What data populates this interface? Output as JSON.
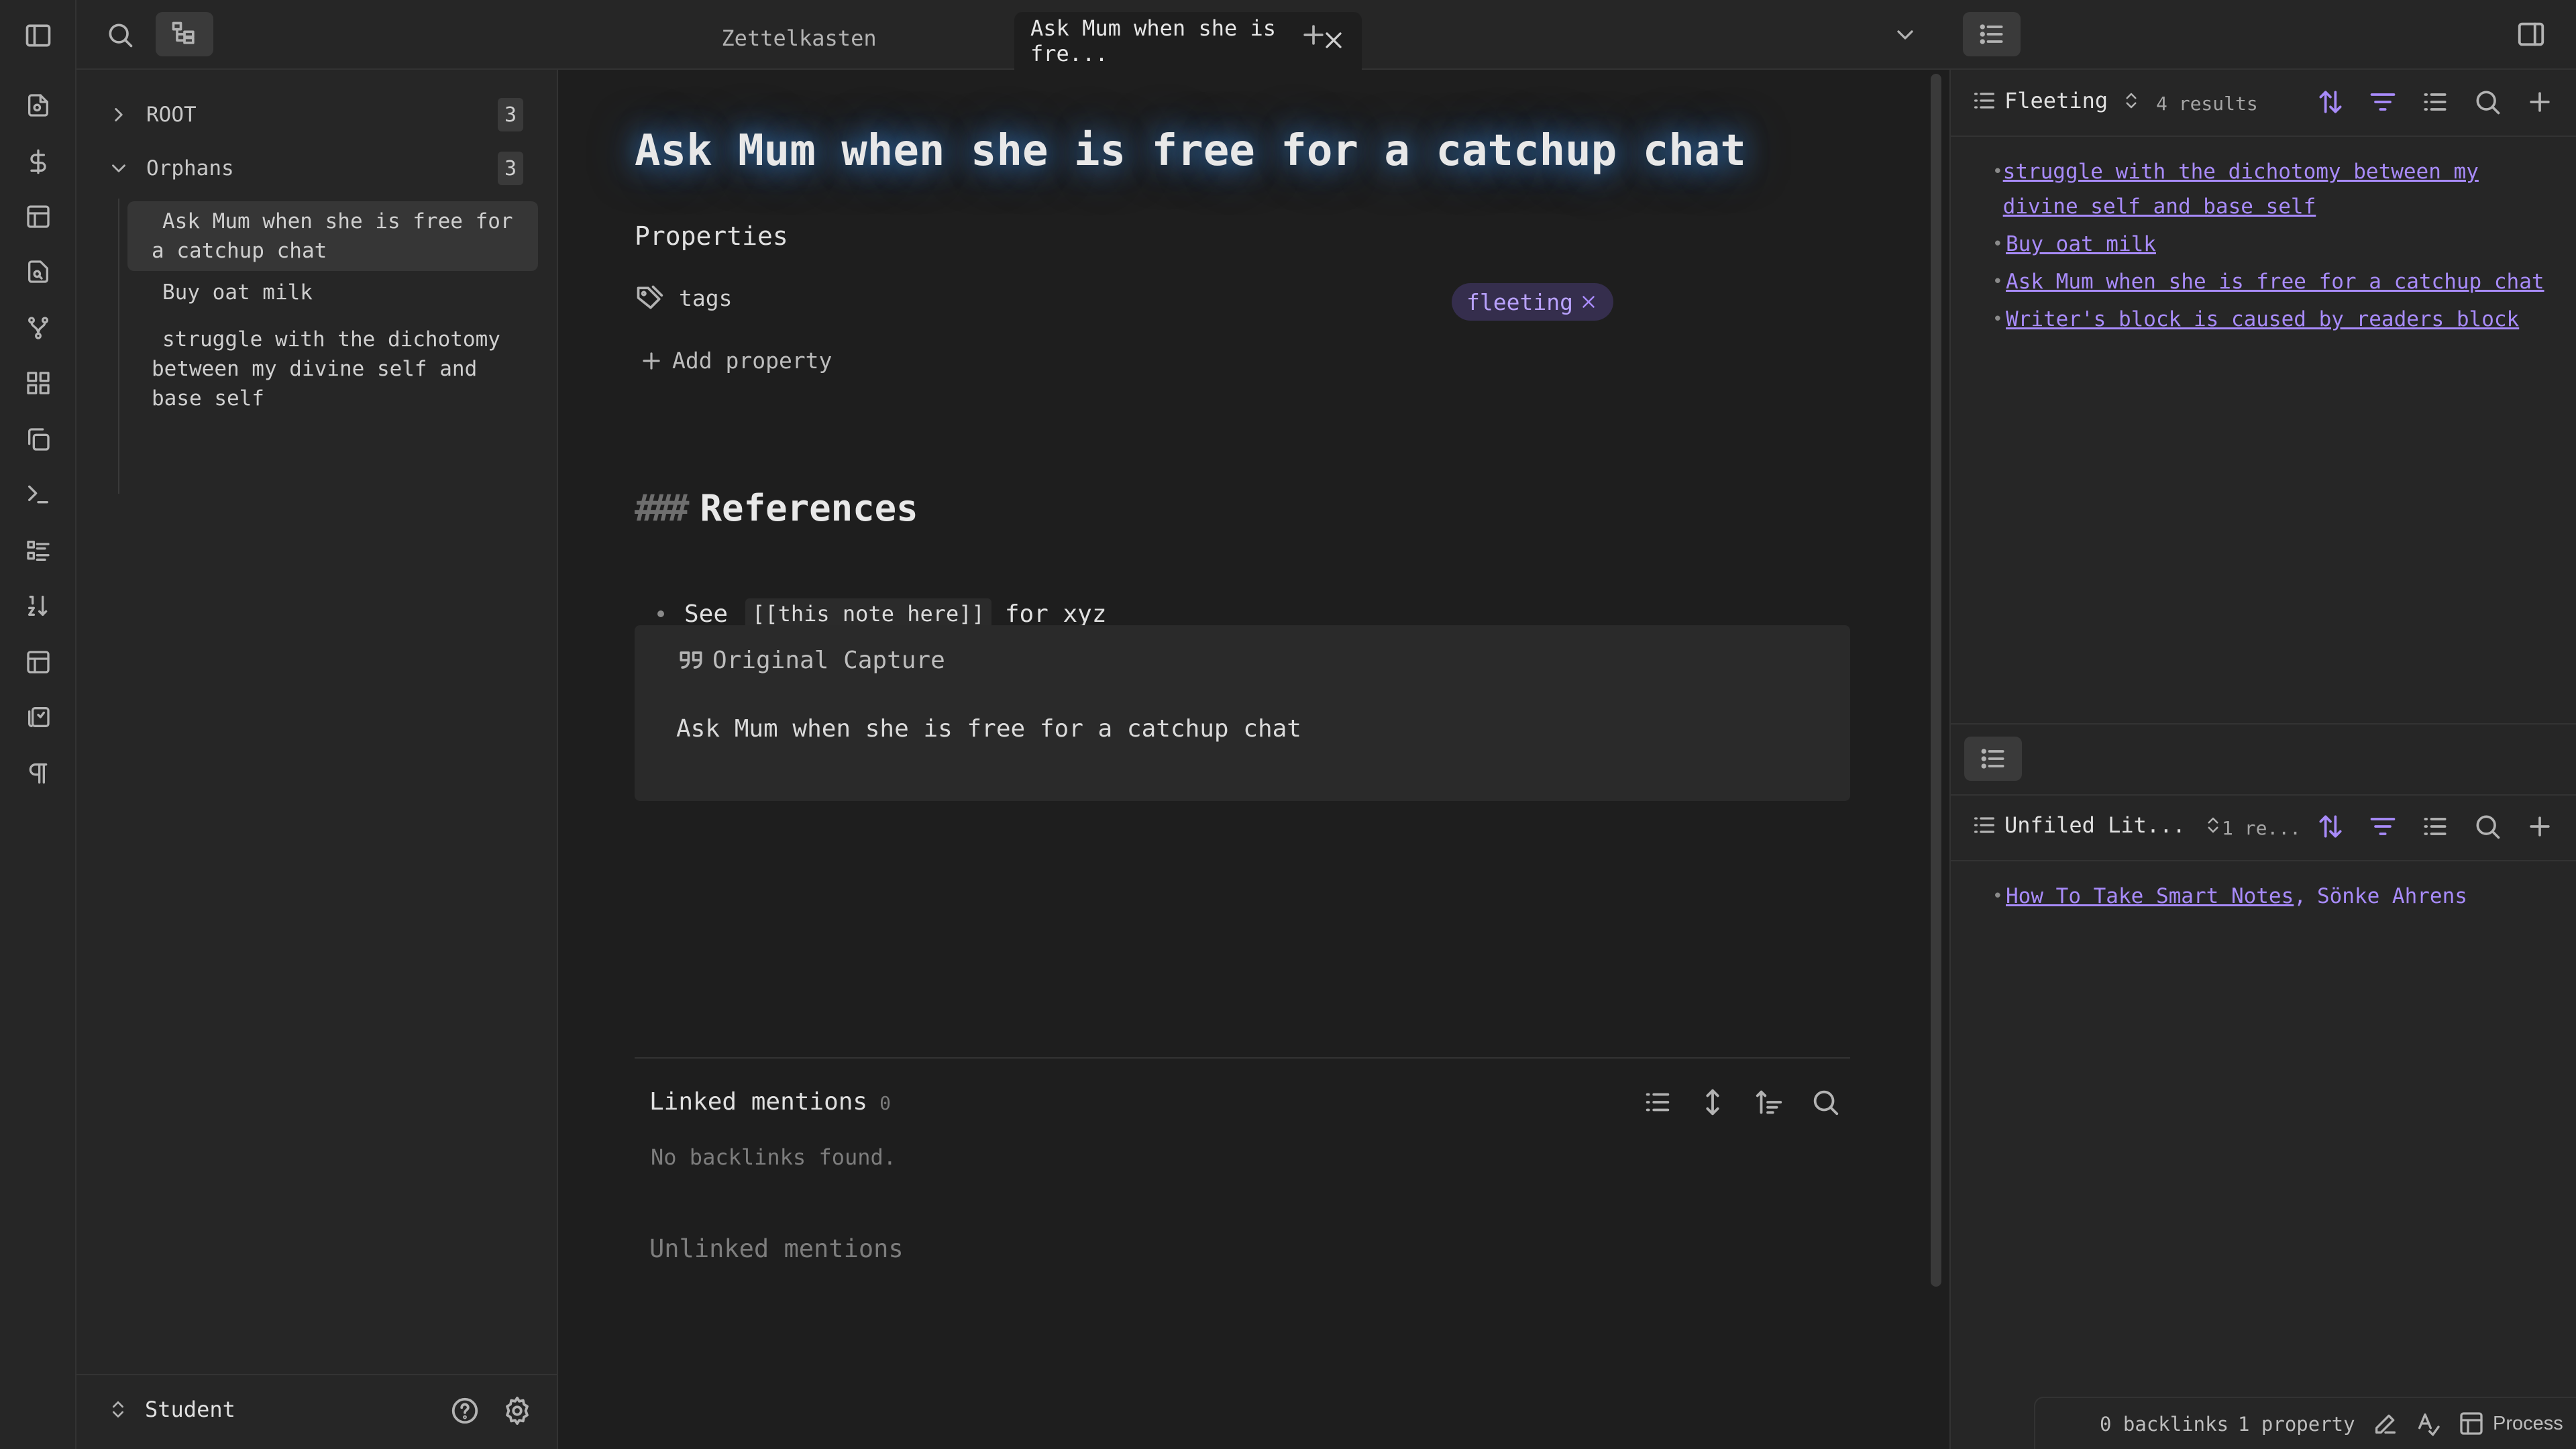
{
  "tabs": [
    {
      "label": "Zettelkasten"
    },
    {
      "label": "Ask Mum when she is fre..."
    }
  ],
  "sidebar": {
    "folders": [
      {
        "label": "ROOT",
        "count": "3"
      },
      {
        "label": "Orphans",
        "count": "3"
      }
    ],
    "items": [
      {
        "label": "Ask Mum when she is free for a catchup chat"
      },
      {
        "label": "Buy oat milk"
      },
      {
        "label": "struggle with the dichotomy between my divine self and base self"
      }
    ],
    "vault_name": "Student"
  },
  "note": {
    "title": "Ask Mum when she is free for a catchup chat",
    "properties_heading": "Properties",
    "property_name": "tags",
    "tag_value": "fleeting",
    "add_property": "Add property",
    "references_heading": "References",
    "references_hash": "###",
    "bullet_prefix": "See",
    "bullet_link": "[[this note here]]",
    "bullet_suffix": "for xyz",
    "callout_title": "Original Capture",
    "callout_body": "Ask Mum when she is free for a catchup chat",
    "linked_mentions": "Linked mentions",
    "linked_count": "0",
    "no_backlinks": "No backlinks found.",
    "unlinked_mentions": "Unlinked mentions"
  },
  "right_top": {
    "query_name": "Fleeting",
    "results": "4 results",
    "items": [
      "struggle with the dichotomy between my divine self and base self",
      "Buy oat milk",
      "Ask Mum when she is free for a catchup chat",
      "Writer's block is caused by readers block"
    ]
  },
  "right_bottom": {
    "query_name": "Unfiled Lit...",
    "results": "1 re...",
    "item_link": "How To Take Smart Notes",
    "item_separator": ",",
    "item_author": "Sönke Ahrens"
  },
  "status": {
    "backlinks": "0 backlinks",
    "properties": "1 property",
    "process": "Process"
  },
  "colors": {
    "accent": "#a88bfa",
    "bg": "#1e1e1e",
    "panel": "#262626"
  }
}
